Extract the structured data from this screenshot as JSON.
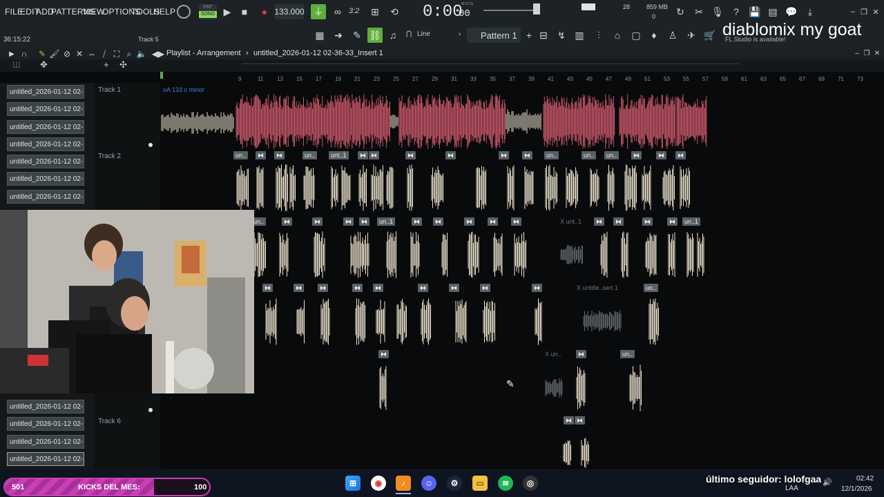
{
  "menu": [
    "FILE",
    "EDIT",
    "ADD",
    "PATTERNS",
    "VIEW",
    "OPTIONS",
    "TOOLS",
    "HELP"
  ],
  "transport": {
    "pat_label": "PAT",
    "song_label": "SONG",
    "tempo": "133.000",
    "time": "0:00",
    "time_small": "00",
    "time_unit": "M:S:CS",
    "cpu": "28",
    "ram": "859 MB",
    "ram_sub": "0"
  },
  "toolbar2": {
    "snap": "Line",
    "pattern": "Pattern 1",
    "hint": "3:2",
    "clock": "36:15:22",
    "track_hint": "Track 5"
  },
  "overlay": {
    "title": "diablomix my goat",
    "update_msg": "FL Studio is available!"
  },
  "playlist": {
    "breadcrumb": "Playlist - Arrangement",
    "separator": "›",
    "name": "untitled_2026-01-12 02-36-33_Insert 1"
  },
  "ruler": [
    "9",
    "11",
    "13",
    "15",
    "17",
    "19",
    "21",
    "23",
    "25",
    "27",
    "29",
    "31",
    "33",
    "35",
    "37",
    "39",
    "41",
    "43",
    "45",
    "47",
    "49",
    "51",
    "53",
    "55",
    "57",
    "59",
    "61",
    "63",
    "65",
    "67",
    "69",
    "71",
    "73"
  ],
  "clip_list": [
    "untitled_2026-01-12 02-...",
    "untitled_2026-01-12 02-...",
    "untitled_2026-01-12 02-...",
    "untitled_2026-01-12 02-...",
    "untitled_2026-01-12 02-...",
    "untitled_2026-01-12 02-...",
    "untitled_2026-01-12 02-...",
    "untitled_2026-01-12 02-...",
    "untitled_2026-01-12 02-...",
    "untitled_2026-01-12 02-...",
    "untitled_2026-01-12 02-..."
  ],
  "tracks": {
    "t1": "Track 1",
    "t2": "Track 2",
    "t6": "Track 6",
    "t1_key": "oA 133 c minor"
  },
  "clip_tags": {
    "un": "un..",
    "unt1": "unt..1",
    "un1": "un..1",
    "xunt1": "X unt..1",
    "xuntitle": "X untitle..sert 1",
    "xun": "X un.."
  },
  "taskbar": {
    "left_value": "501",
    "left_label": "KICKS DEL MES:",
    "left_target": "100",
    "follower": "último seguidor: lolofgaa",
    "lang": "LAA",
    "time": "02:42",
    "date": "12/1/2026",
    "progress_fraction": 0.73
  },
  "colors": {
    "accent_green": "#5fae3c",
    "clip_red": "#c8576a",
    "clip_cream": "#efe6d0",
    "pink_bar": "#c93fb5"
  }
}
